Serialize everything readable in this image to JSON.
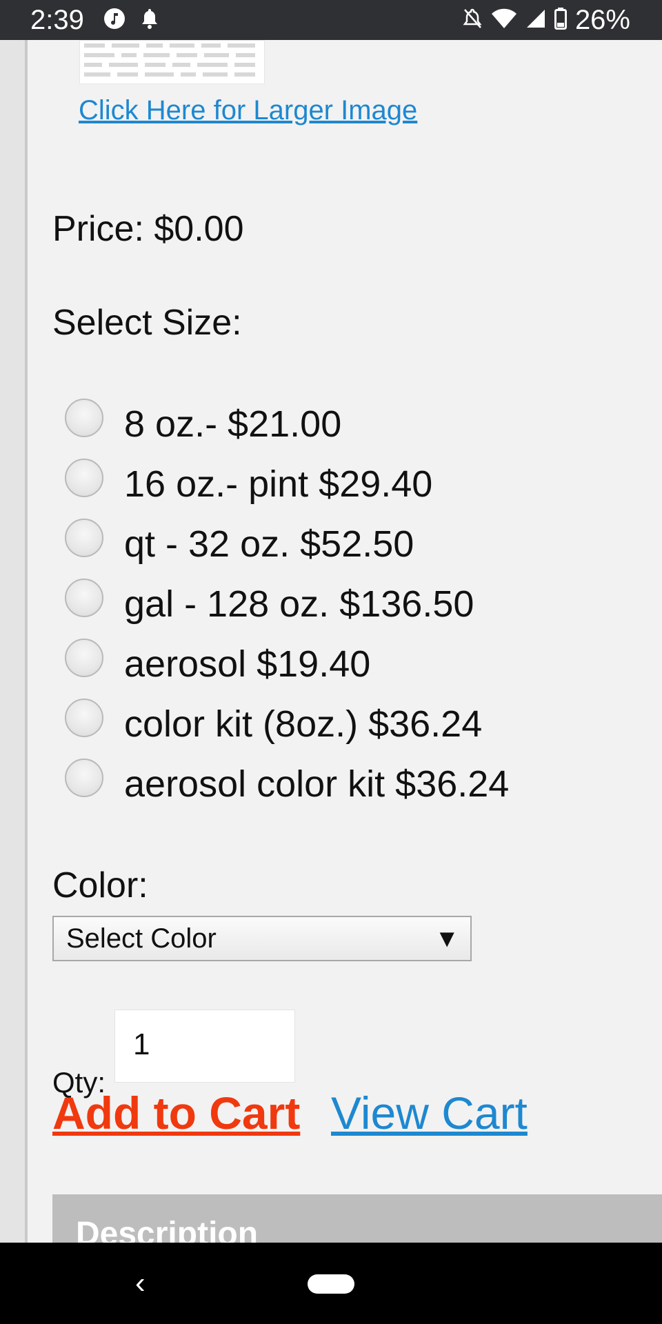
{
  "status_bar": {
    "time": "2:39",
    "battery_text": "26%",
    "icons": [
      "music-icon",
      "notification-bell-icon",
      "silent-bell-icon",
      "wifi-icon",
      "signal-icon",
      "battery-icon"
    ]
  },
  "product": {
    "larger_image_link": "Click Here for Larger Image",
    "price": "Price: $0.00",
    "select_size_label": "Select Size:",
    "sizes": [
      {
        "label": "8 oz.- $21.00"
      },
      {
        "label": "16 oz.- pint $29.40"
      },
      {
        "label": "qt - 32 oz. $52.50"
      },
      {
        "label": "gal - 128 oz. $136.50"
      },
      {
        "label": "aerosol $19.40"
      },
      {
        "label": "color kit (8oz.) $36.24"
      },
      {
        "label": "aerosol color kit $36.24"
      }
    ],
    "color_label": "Color:",
    "color_select_value": "Select Color",
    "color_arrow": "▼",
    "qty_label": "Qty:",
    "qty_value": "1",
    "add_to_cart": "Add to Cart",
    "view_cart": "View Cart",
    "description_title": "Description"
  },
  "nav_bar": {
    "back_glyph": "‹"
  },
  "colors": {
    "link_blue": "#1e88d0",
    "add_to_cart_red": "#f0390f",
    "status_bar_bg": "#2f3033",
    "description_bar_bg": "#bdbdbd"
  }
}
